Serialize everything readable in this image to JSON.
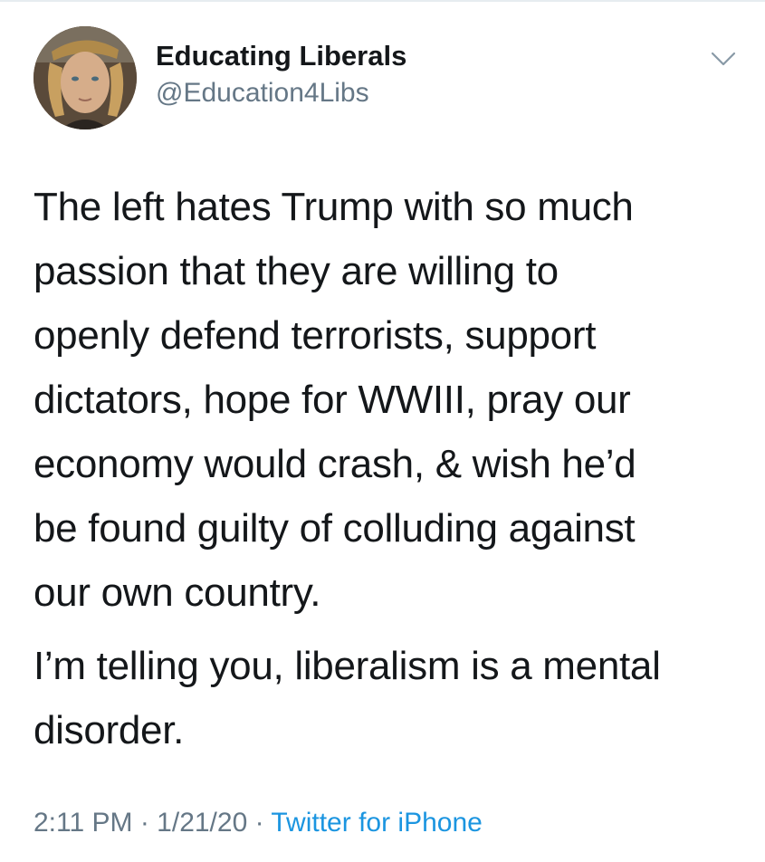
{
  "profile": {
    "display_name": "Educating Liberals",
    "handle": "@Education4Libs",
    "avatar_icon": "user-photo-avatar"
  },
  "menu": {
    "icon": "chevron-down-icon"
  },
  "tweet": {
    "paragraphs": [
      "The left hates Trump with so much\npassion that they are willing to\nopenly defend terrorists, support\ndictators, hope for WWIII, pray our\neconomy would crash, & wish he’d\nbe found guilty of colluding against\nour own country.",
      "I’m telling you, liberalism is a mental\ndisorder."
    ]
  },
  "meta": {
    "time": "2:11 PM",
    "separator": " · ",
    "date": "1/21/20",
    "source": "Twitter for iPhone"
  },
  "colors": {
    "text": "#14171a",
    "secondary": "#657786",
    "link": "#1b95e0"
  }
}
